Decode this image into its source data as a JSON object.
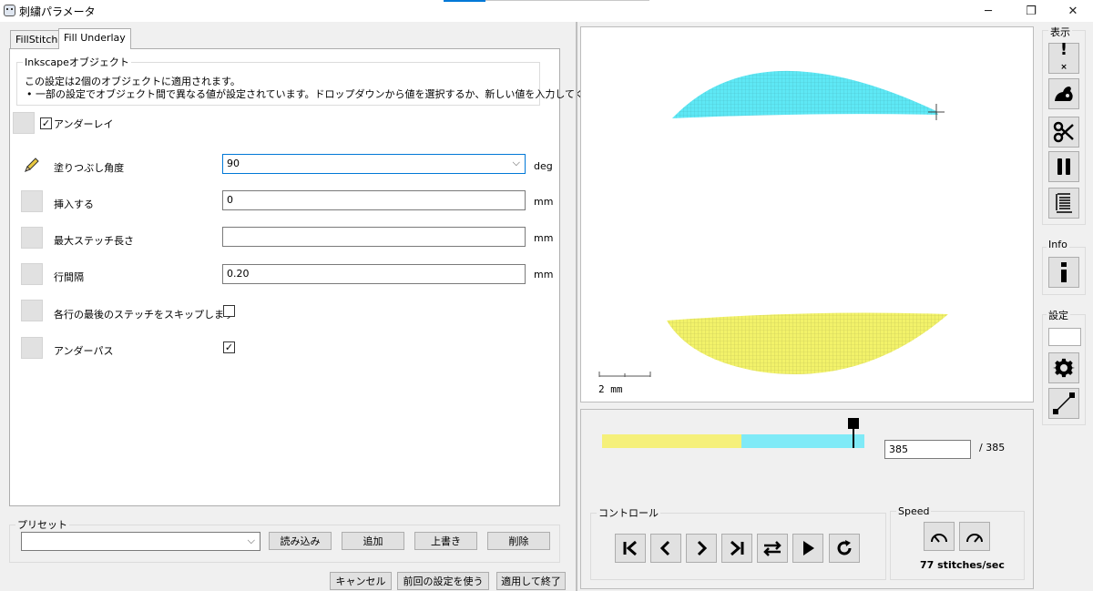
{
  "window": {
    "title": "刺繍パラメータ",
    "minimize_glyph": "─",
    "maximize_glyph": "❐",
    "close_glyph": "✕"
  },
  "tabs": [
    {
      "label": "FillStitch",
      "active": false
    },
    {
      "label": "Fill Underlay",
      "active": true
    }
  ],
  "info_box": {
    "legend": "Inkscapeオブジェクト",
    "line1": "この設定は2個のオブジェクトに適用されます。",
    "line2": "• 一部の設定でオブジェクト間で異なる値が設定されています。ドロップダウンから値を選択するか、新しい値を入力してください。"
  },
  "underlay_toggle": {
    "label": "アンダーレイ",
    "checked": true
  },
  "params": [
    {
      "label": "塗りつぶし角度",
      "value": "90",
      "unit": "deg",
      "icon": "pencil-icon"
    },
    {
      "label": "挿入する",
      "value": "0",
      "unit": "mm"
    },
    {
      "label": "最大ステッチ長さ",
      "value": "",
      "unit": "mm"
    },
    {
      "label": "行間隔",
      "value": "0.20",
      "unit": "mm"
    },
    {
      "label": "各行の最後のステッチをスキップします",
      "checked": false
    },
    {
      "label": "アンダーパス",
      "checked": true
    }
  ],
  "preset": {
    "legend": "プリセット",
    "value": "",
    "load_label": "読み込み",
    "add_label": "追加",
    "overwrite_label": "上書き",
    "delete_label": "削除"
  },
  "footer": {
    "cancel_label": "キャンセル",
    "use_last_label": "前回の設定を使う",
    "apply_label": "適用して終了"
  },
  "preview": {
    "scale_label": "2 mm",
    "colors": {
      "shape1": "#5ee8f5",
      "shape2": "#f2f26a"
    }
  },
  "slider": {
    "value": "385",
    "total_label": "/ 385",
    "progress_fraction": 1.0,
    "colors": {
      "yellow": "#f5f07a",
      "cyan": "#7feaf7"
    }
  },
  "controls": {
    "legend": "コントロール",
    "buttons": [
      "skip-to-start-icon",
      "previous-icon",
      "next-icon",
      "skip-to-end-icon",
      "swap-direction-icon",
      "play-icon",
      "restart-icon"
    ]
  },
  "speed": {
    "legend": "Speed",
    "rate_label": "77 stitches/sec",
    "buttons": [
      "slower-icon",
      "faster-icon"
    ]
  },
  "sidebar": {
    "display_label": "表示",
    "info_label": "Info",
    "settings_label": "設定",
    "display_buttons": [
      "exclamation-icon",
      "rabbit-icon",
      "scissors-icon",
      "pause-icon",
      "stitch-list-icon"
    ],
    "info_buttons": [
      "info-icon"
    ],
    "settings_buttons": [
      "gear-icon",
      "resize-icon"
    ]
  }
}
